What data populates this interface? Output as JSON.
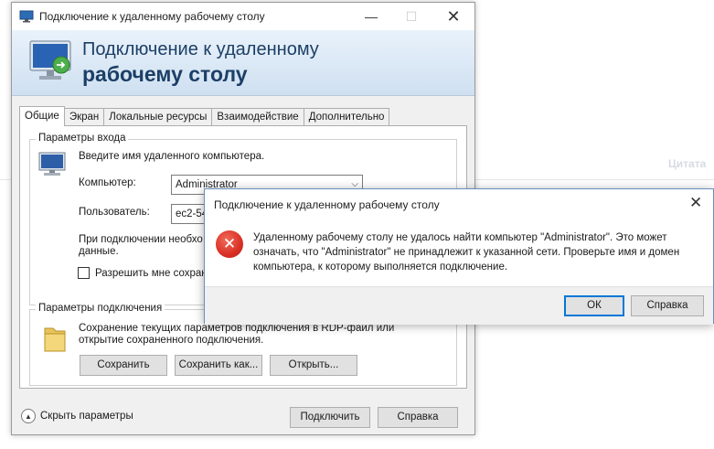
{
  "background": {
    "quote_label": "Цитата"
  },
  "window": {
    "title": "Подключение к удаленному рабочему столу",
    "banner_line1": "Подключение к удаленному",
    "banner_line2": "рабочему столу",
    "tabs": [
      {
        "label": "Общие",
        "active": true
      },
      {
        "label": "Экран",
        "active": false
      },
      {
        "label": "Локальные ресурсы",
        "active": false
      },
      {
        "label": "Взаимодействие",
        "active": false
      },
      {
        "label": "Дополнительно",
        "active": false
      }
    ],
    "login_group": {
      "legend": "Параметры входа",
      "prompt": "Введите имя удаленного компьютера.",
      "computer_label": "Компьютер:",
      "computer_value": "Administrator",
      "user_label": "Пользователь:",
      "user_value": "ec2-54-1",
      "note_line1": "При подключении необхо",
      "note_line2": "данные.",
      "checkbox_label": "Разрешить мне сохраня"
    },
    "conn_group": {
      "legend": "Параметры подключения",
      "line1": "Сохранение текущих параметров подключения в RDP-файл или",
      "line2": "открытие сохраненного подключения.",
      "save_button": "Сохранить",
      "save_as_button": "Сохранить как...",
      "open_button": "Открыть..."
    },
    "hide_options": "Скрыть параметры",
    "connect_button": "Подключить",
    "help_button": "Справка"
  },
  "error_dialog": {
    "title": "Подключение к удаленному рабочему столу",
    "message_line1": "Удаленному рабочему столу не удалось найти компьютер \"Administrator\". Это может",
    "message_line2": "означать, что \"Administrator\" не принадлежит к указанной сети. Проверьте имя и домен",
    "message_line3": "компьютера, к которому выполняется подключение.",
    "ok_button": "ОК",
    "help_button": "Справка"
  },
  "colors": {
    "banner_text": "#1c3f66",
    "error_red": "#d93025",
    "default_button_border": "#0078d7"
  }
}
